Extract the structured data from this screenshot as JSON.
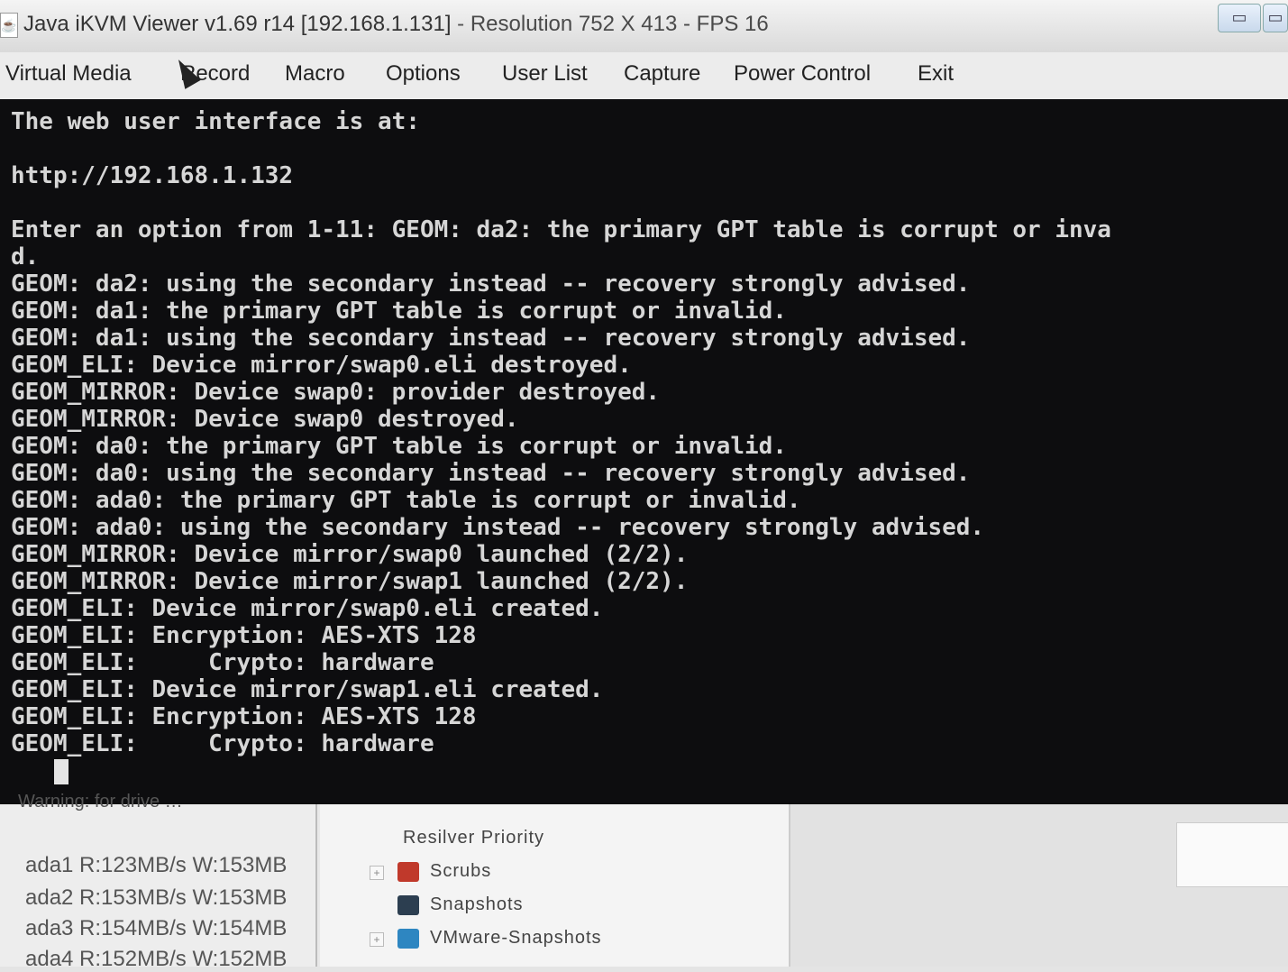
{
  "window": {
    "title_main": "Java iKVM Viewer v1.69 r14 [192.168.1.131]",
    "title_sep": " - ",
    "title_status": "Resolution 752 X 413 - FPS 16",
    "minimize_label": "▭",
    "restore_label": "▭"
  },
  "menu": {
    "items": [
      "Virtual Media",
      "Record",
      "Macro",
      "Options",
      "User List",
      "Capture",
      "Power Control",
      "Exit"
    ]
  },
  "console": {
    "lines": [
      "The web user interface is at:",
      "",
      "http://192.168.1.132",
      "",
      "Enter an option from 1-11: GEOM: da2: the primary GPT table is corrupt or inva",
      "d.",
      "GEOM: da2: using the secondary instead -- recovery strongly advised.",
      "GEOM: da1: the primary GPT table is corrupt or invalid.",
      "GEOM: da1: using the secondary instead -- recovery strongly advised.",
      "GEOM_ELI: Device mirror/swap0.eli destroyed.",
      "GEOM_MIRROR: Device swap0: provider destroyed.",
      "GEOM_MIRROR: Device swap0 destroyed.",
      "GEOM: da0: the primary GPT table is corrupt or invalid.",
      "GEOM: da0: using the secondary instead -- recovery strongly advised.",
      "GEOM: ada0: the primary GPT table is corrupt or invalid.",
      "GEOM: ada0: using the secondary instead -- recovery strongly advised.",
      "GEOM_MIRROR: Device mirror/swap0 launched (2/2).",
      "GEOM_MIRROR: Device mirror/swap1 launched (2/2).",
      "GEOM_ELI: Device mirror/swap0.eli created.",
      "GEOM_ELI: Encryption: AES-XTS 128",
      "GEOM_ELI:     Crypto: hardware",
      "GEOM_ELI: Device mirror/swap1.eli created.",
      "GEOM_ELI: Encryption: AES-XTS 128",
      "GEOM_ELI:     Crypto: hardware"
    ]
  },
  "background": {
    "warning": "Warning: for drive …",
    "disk_stats": [
      "ada1 R:123MB/s W:153MB",
      "ada2 R:153MB/s W:153MB",
      "ada3 R:154MB/s W:154MB",
      "ada4 R:152MB/s W:152MB"
    ],
    "tree": {
      "resilver": "Resilver Priority",
      "scrubs": "Scrubs",
      "snapshots": "Snapshots",
      "vmware": "VMware-Snapshots"
    },
    "colors": {
      "scrubs_icon": "#c0392b",
      "snapshots_icon": "#2c3e50",
      "vmware_icon": "#2e86c1"
    }
  }
}
